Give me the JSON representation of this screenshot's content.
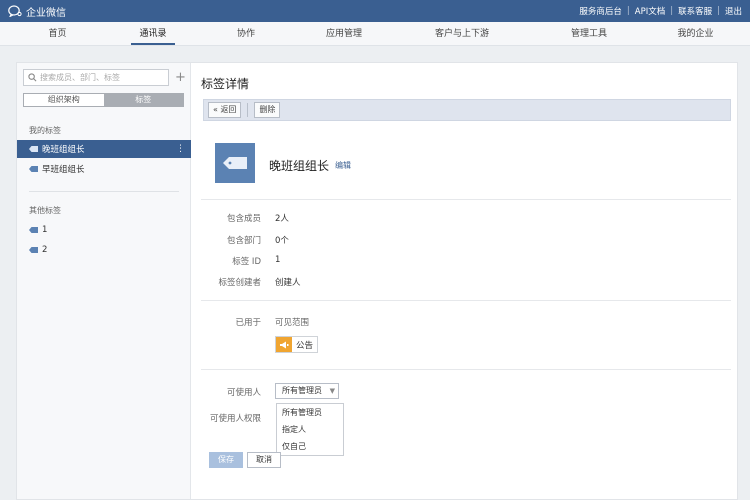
{
  "topbar": {
    "brand": "企业微信",
    "links": [
      "服务商后台",
      "API文档",
      "联系客服",
      "退出"
    ]
  },
  "nav": {
    "items": [
      "首页",
      "通讯录",
      "协作",
      "应用管理",
      "客户与上下游",
      "管理工具",
      "我的企业"
    ],
    "active_index": 1
  },
  "sidebar": {
    "search_placeholder": "搜索成员、部门、标签",
    "seg_left": "组织架构",
    "seg_right": "标签",
    "my_tags_title": "我的标签",
    "my_tags": [
      "晚班组组长",
      "早班组组长"
    ],
    "selected_tag": "晚班组组长",
    "other_tags_title": "其他标签",
    "other_tags": [
      "1",
      "2"
    ]
  },
  "detail": {
    "page_title": "标签详情",
    "back_label": "« 返回",
    "delete_label": "删除",
    "tag_name": "晚班组组长",
    "edit_label": "编辑",
    "fields": [
      {
        "label": "包含成员",
        "value": "2人"
      },
      {
        "label": "包含部门",
        "value": "0个"
      },
      {
        "label": "标签 ID",
        "value": "1"
      },
      {
        "label": "标签创建者",
        "value": "创建人"
      }
    ],
    "used_in_label": "已用于",
    "used_in_value": "可见范围",
    "notice_label": "公告",
    "users_label": "可使用人",
    "users_select": "所有管理员",
    "perm_label": "可使用人权限",
    "dropdown_options": [
      "所有管理员",
      "指定人",
      "仅自己"
    ],
    "save_label": "保存",
    "cancel_label": "取消"
  },
  "colors": {
    "brand_blue": "#3a5f91",
    "tag_blue": "#5b82b3",
    "notice_orange": "#f0a531"
  }
}
